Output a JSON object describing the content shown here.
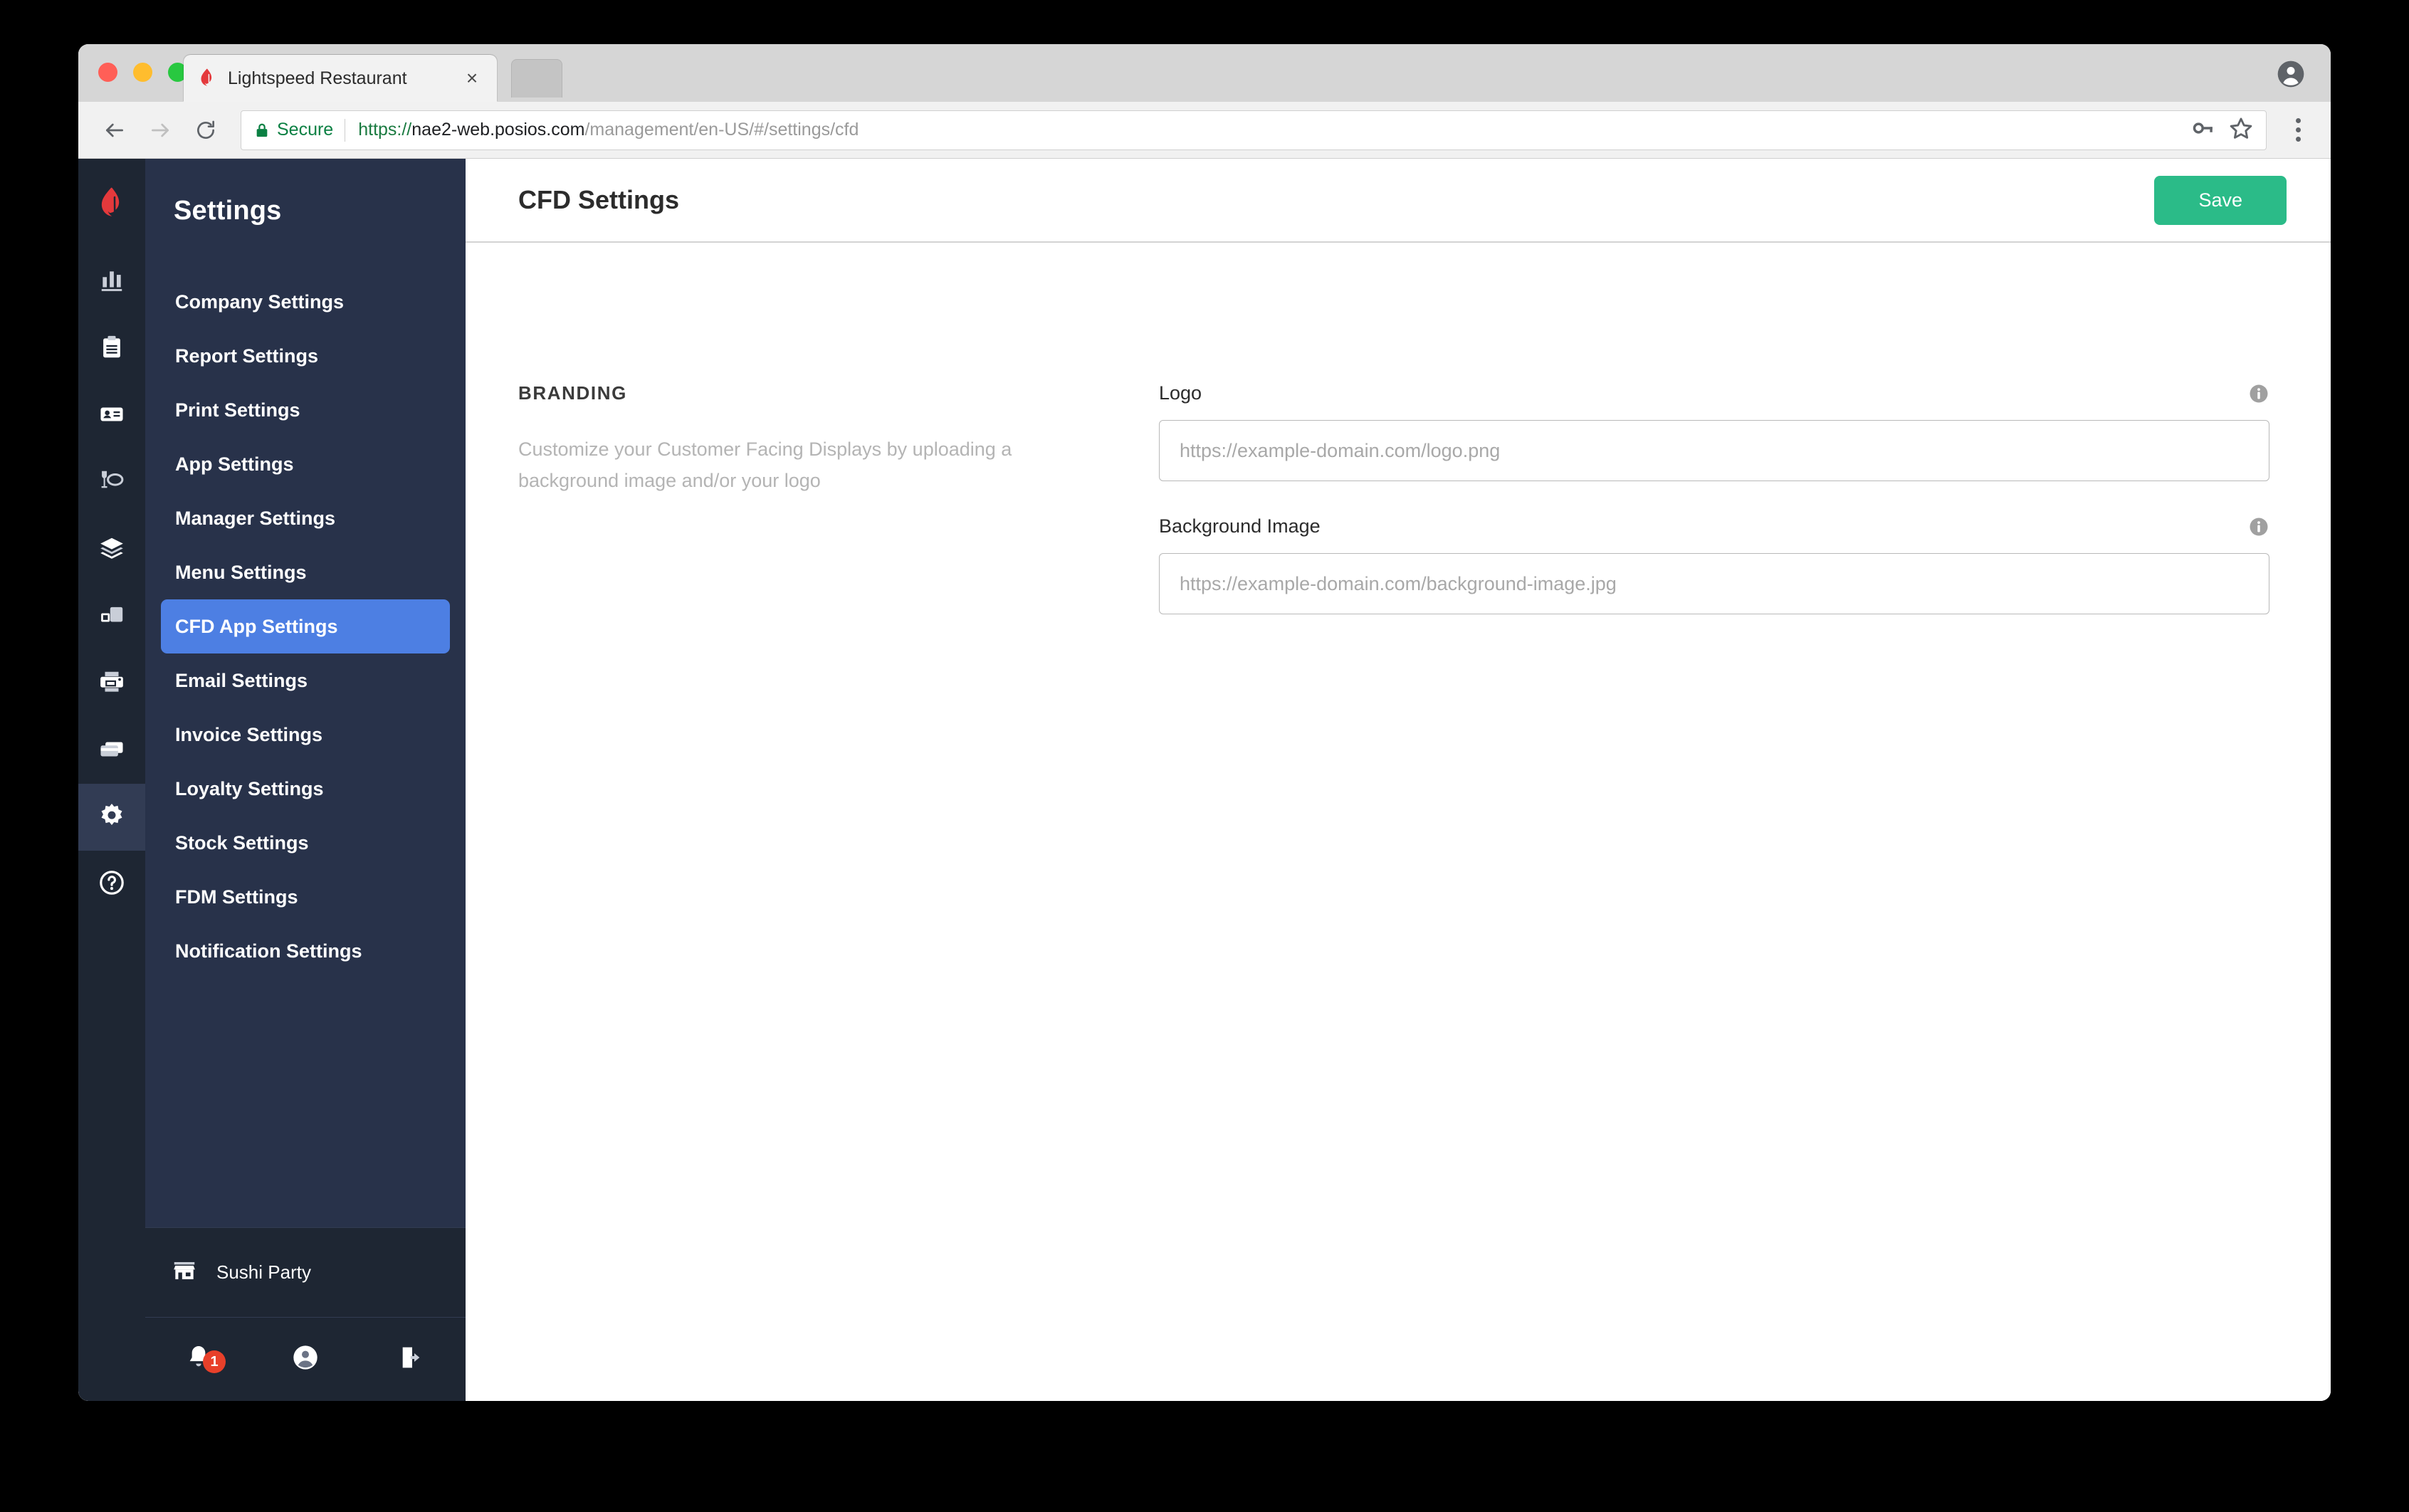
{
  "browser": {
    "tab": {
      "title": "Lightspeed Restaurant",
      "favicon": "lightspeed-flame-icon",
      "close": "×"
    },
    "omnibox": {
      "security_label": "Secure",
      "url_scheme": "https://",
      "url_host": "nae2-web.posios.com",
      "url_path": "/management/en-US/#/settings/cfd",
      "full_url": "https://nae2-web.posios.com/management/en-US/#/settings/cfd"
    },
    "icons": {
      "back": "back-arrow-icon",
      "forward": "forward-arrow-icon",
      "reload": "reload-icon",
      "lock": "lock-icon",
      "password": "key-icon",
      "bookmark": "star-icon",
      "menu": "three-dots-icon",
      "profile": "chrome-profile-icon"
    }
  },
  "sidebar": {
    "title": "Settings",
    "items": [
      {
        "label": "Company Settings",
        "icon": "bar-chart-icon",
        "active": false
      },
      {
        "label": "Report Settings",
        "icon": "clipboard-icon",
        "active": false
      },
      {
        "label": "Print Settings",
        "icon": "id-card-icon",
        "active": false
      },
      {
        "label": "App Settings",
        "icon": "dining-icon",
        "active": false
      },
      {
        "label": "Manager Settings",
        "icon": "layers-icon",
        "active": false
      },
      {
        "label": "Menu Settings",
        "icon": "devices-icon",
        "active": false
      },
      {
        "label": "CFD App Settings",
        "icon": "printer-icon",
        "active": true
      },
      {
        "label": "Email Settings",
        "icon": "card-icon",
        "active": false
      },
      {
        "label": "Invoice Settings",
        "icon": "gear-icon",
        "active": false
      },
      {
        "label": "Loyalty Settings",
        "icon": "help-icon",
        "active": false
      },
      {
        "label": "Stock Settings",
        "icon": "",
        "active": false
      },
      {
        "label": "FDM Settings",
        "icon": "",
        "active": false
      },
      {
        "label": "Notification Settings",
        "icon": "",
        "active": false
      }
    ],
    "store": {
      "name": "Sushi Party",
      "icon": "store-icon"
    },
    "footer": {
      "notifications": {
        "icon": "bell-icon",
        "badge": "1"
      },
      "account": {
        "icon": "user-circle-icon"
      },
      "logout": {
        "icon": "logout-icon"
      }
    }
  },
  "main": {
    "title": "CFD Settings",
    "save_label": "Save",
    "branding": {
      "heading": "BRANDING",
      "description": "Customize your Customer Facing Displays by uploading a background image and/or your logo"
    },
    "fields": [
      {
        "label": "Logo",
        "value": "",
        "placeholder": "https://example-domain.com/logo.png",
        "info": "info-icon"
      },
      {
        "label": "Background Image",
        "value": "",
        "placeholder": "https://example-domain.com/background-image.jpg",
        "info": "info-icon"
      }
    ]
  },
  "colors": {
    "rail": "#1e2633",
    "sidebar": "#28324a",
    "active_nav": "#4d7fe3",
    "save_green": "#2bbb88",
    "brand_red": "#e4393c",
    "badge_red": "#e8402a",
    "secure_green": "#0b8043"
  }
}
